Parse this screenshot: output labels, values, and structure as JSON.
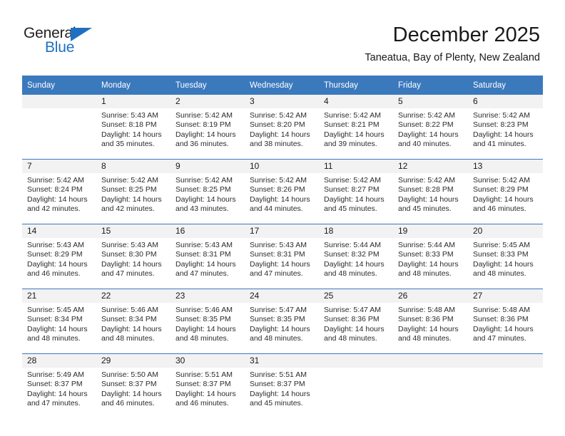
{
  "brand": {
    "name_part1": "General",
    "name_part2": "Blue",
    "accent_color": "#1f70c1"
  },
  "header": {
    "title": "December 2025",
    "subtitle": "Taneatua, Bay of Plenty, New Zealand"
  },
  "calendar": {
    "header_bg": "#3b79bd",
    "daynum_bg": "#f2f2f2",
    "weekdays": [
      "Sunday",
      "Monday",
      "Tuesday",
      "Wednesday",
      "Thursday",
      "Friday",
      "Saturday"
    ],
    "weeks": [
      [
        {
          "day": "",
          "sunrise": "",
          "sunset": "",
          "daylight_line1": "",
          "daylight_line2": ""
        },
        {
          "day": "1",
          "sunrise": "Sunrise: 5:43 AM",
          "sunset": "Sunset: 8:18 PM",
          "daylight_line1": "Daylight: 14 hours",
          "daylight_line2": "and 35 minutes."
        },
        {
          "day": "2",
          "sunrise": "Sunrise: 5:42 AM",
          "sunset": "Sunset: 8:19 PM",
          "daylight_line1": "Daylight: 14 hours",
          "daylight_line2": "and 36 minutes."
        },
        {
          "day": "3",
          "sunrise": "Sunrise: 5:42 AM",
          "sunset": "Sunset: 8:20 PM",
          "daylight_line1": "Daylight: 14 hours",
          "daylight_line2": "and 38 minutes."
        },
        {
          "day": "4",
          "sunrise": "Sunrise: 5:42 AM",
          "sunset": "Sunset: 8:21 PM",
          "daylight_line1": "Daylight: 14 hours",
          "daylight_line2": "and 39 minutes."
        },
        {
          "day": "5",
          "sunrise": "Sunrise: 5:42 AM",
          "sunset": "Sunset: 8:22 PM",
          "daylight_line1": "Daylight: 14 hours",
          "daylight_line2": "and 40 minutes."
        },
        {
          "day": "6",
          "sunrise": "Sunrise: 5:42 AM",
          "sunset": "Sunset: 8:23 PM",
          "daylight_line1": "Daylight: 14 hours",
          "daylight_line2": "and 41 minutes."
        }
      ],
      [
        {
          "day": "7",
          "sunrise": "Sunrise: 5:42 AM",
          "sunset": "Sunset: 8:24 PM",
          "daylight_line1": "Daylight: 14 hours",
          "daylight_line2": "and 42 minutes."
        },
        {
          "day": "8",
          "sunrise": "Sunrise: 5:42 AM",
          "sunset": "Sunset: 8:25 PM",
          "daylight_line1": "Daylight: 14 hours",
          "daylight_line2": "and 42 minutes."
        },
        {
          "day": "9",
          "sunrise": "Sunrise: 5:42 AM",
          "sunset": "Sunset: 8:25 PM",
          "daylight_line1": "Daylight: 14 hours",
          "daylight_line2": "and 43 minutes."
        },
        {
          "day": "10",
          "sunrise": "Sunrise: 5:42 AM",
          "sunset": "Sunset: 8:26 PM",
          "daylight_line1": "Daylight: 14 hours",
          "daylight_line2": "and 44 minutes."
        },
        {
          "day": "11",
          "sunrise": "Sunrise: 5:42 AM",
          "sunset": "Sunset: 8:27 PM",
          "daylight_line1": "Daylight: 14 hours",
          "daylight_line2": "and 45 minutes."
        },
        {
          "day": "12",
          "sunrise": "Sunrise: 5:42 AM",
          "sunset": "Sunset: 8:28 PM",
          "daylight_line1": "Daylight: 14 hours",
          "daylight_line2": "and 45 minutes."
        },
        {
          "day": "13",
          "sunrise": "Sunrise: 5:42 AM",
          "sunset": "Sunset: 8:29 PM",
          "daylight_line1": "Daylight: 14 hours",
          "daylight_line2": "and 46 minutes."
        }
      ],
      [
        {
          "day": "14",
          "sunrise": "Sunrise: 5:43 AM",
          "sunset": "Sunset: 8:29 PM",
          "daylight_line1": "Daylight: 14 hours",
          "daylight_line2": "and 46 minutes."
        },
        {
          "day": "15",
          "sunrise": "Sunrise: 5:43 AM",
          "sunset": "Sunset: 8:30 PM",
          "daylight_line1": "Daylight: 14 hours",
          "daylight_line2": "and 47 minutes."
        },
        {
          "day": "16",
          "sunrise": "Sunrise: 5:43 AM",
          "sunset": "Sunset: 8:31 PM",
          "daylight_line1": "Daylight: 14 hours",
          "daylight_line2": "and 47 minutes."
        },
        {
          "day": "17",
          "sunrise": "Sunrise: 5:43 AM",
          "sunset": "Sunset: 8:31 PM",
          "daylight_line1": "Daylight: 14 hours",
          "daylight_line2": "and 47 minutes."
        },
        {
          "day": "18",
          "sunrise": "Sunrise: 5:44 AM",
          "sunset": "Sunset: 8:32 PM",
          "daylight_line1": "Daylight: 14 hours",
          "daylight_line2": "and 48 minutes."
        },
        {
          "day": "19",
          "sunrise": "Sunrise: 5:44 AM",
          "sunset": "Sunset: 8:33 PM",
          "daylight_line1": "Daylight: 14 hours",
          "daylight_line2": "and 48 minutes."
        },
        {
          "day": "20",
          "sunrise": "Sunrise: 5:45 AM",
          "sunset": "Sunset: 8:33 PM",
          "daylight_line1": "Daylight: 14 hours",
          "daylight_line2": "and 48 minutes."
        }
      ],
      [
        {
          "day": "21",
          "sunrise": "Sunrise: 5:45 AM",
          "sunset": "Sunset: 8:34 PM",
          "daylight_line1": "Daylight: 14 hours",
          "daylight_line2": "and 48 minutes."
        },
        {
          "day": "22",
          "sunrise": "Sunrise: 5:46 AM",
          "sunset": "Sunset: 8:34 PM",
          "daylight_line1": "Daylight: 14 hours",
          "daylight_line2": "and 48 minutes."
        },
        {
          "day": "23",
          "sunrise": "Sunrise: 5:46 AM",
          "sunset": "Sunset: 8:35 PM",
          "daylight_line1": "Daylight: 14 hours",
          "daylight_line2": "and 48 minutes."
        },
        {
          "day": "24",
          "sunrise": "Sunrise: 5:47 AM",
          "sunset": "Sunset: 8:35 PM",
          "daylight_line1": "Daylight: 14 hours",
          "daylight_line2": "and 48 minutes."
        },
        {
          "day": "25",
          "sunrise": "Sunrise: 5:47 AM",
          "sunset": "Sunset: 8:36 PM",
          "daylight_line1": "Daylight: 14 hours",
          "daylight_line2": "and 48 minutes."
        },
        {
          "day": "26",
          "sunrise": "Sunrise: 5:48 AM",
          "sunset": "Sunset: 8:36 PM",
          "daylight_line1": "Daylight: 14 hours",
          "daylight_line2": "and 48 minutes."
        },
        {
          "day": "27",
          "sunrise": "Sunrise: 5:48 AM",
          "sunset": "Sunset: 8:36 PM",
          "daylight_line1": "Daylight: 14 hours",
          "daylight_line2": "and 47 minutes."
        }
      ],
      [
        {
          "day": "28",
          "sunrise": "Sunrise: 5:49 AM",
          "sunset": "Sunset: 8:37 PM",
          "daylight_line1": "Daylight: 14 hours",
          "daylight_line2": "and 47 minutes."
        },
        {
          "day": "29",
          "sunrise": "Sunrise: 5:50 AM",
          "sunset": "Sunset: 8:37 PM",
          "daylight_line1": "Daylight: 14 hours",
          "daylight_line2": "and 46 minutes."
        },
        {
          "day": "30",
          "sunrise": "Sunrise: 5:51 AM",
          "sunset": "Sunset: 8:37 PM",
          "daylight_line1": "Daylight: 14 hours",
          "daylight_line2": "and 46 minutes."
        },
        {
          "day": "31",
          "sunrise": "Sunrise: 5:51 AM",
          "sunset": "Sunset: 8:37 PM",
          "daylight_line1": "Daylight: 14 hours",
          "daylight_line2": "and 45 minutes."
        },
        {
          "day": "",
          "sunrise": "",
          "sunset": "",
          "daylight_line1": "",
          "daylight_line2": ""
        },
        {
          "day": "",
          "sunrise": "",
          "sunset": "",
          "daylight_line1": "",
          "daylight_line2": ""
        },
        {
          "day": "",
          "sunrise": "",
          "sunset": "",
          "daylight_line1": "",
          "daylight_line2": ""
        }
      ]
    ]
  }
}
